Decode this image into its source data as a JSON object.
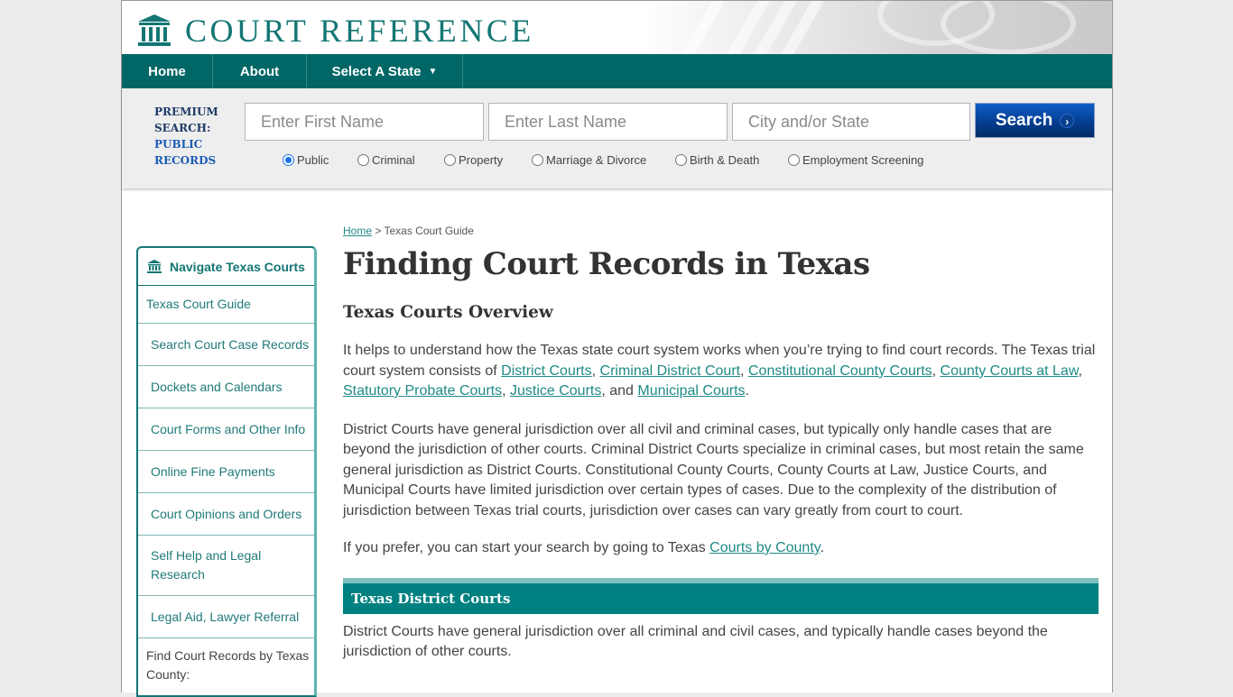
{
  "brand": {
    "name": "COURT REFERENCE",
    "accent": "#006766",
    "link": "#1f8a86"
  },
  "nav": [
    {
      "label": "Home"
    },
    {
      "label": "About"
    },
    {
      "label": "Select A State",
      "caret": "▼"
    }
  ],
  "search": {
    "premium_line1": "PREMIUM",
    "premium_line2": "SEARCH:",
    "premium_line3": "PUBLIC",
    "premium_line4": "RECORDS",
    "first_name_placeholder": "Enter First Name",
    "last_name_placeholder": "Enter Last Name",
    "city_state_placeholder": "City and/or State",
    "button_label": "Search",
    "button_arrow": "›",
    "radios": [
      {
        "label": "Public",
        "checked": true
      },
      {
        "label": "Criminal",
        "checked": false
      },
      {
        "label": "Property",
        "checked": false
      },
      {
        "label": "Marriage & Divorce",
        "checked": false
      },
      {
        "label": "Birth & Death",
        "checked": false
      },
      {
        "label": "Employment Screening",
        "checked": false
      }
    ]
  },
  "sidebar": {
    "title": "Navigate Texas Courts",
    "items": [
      {
        "label": "Texas Court Guide"
      },
      {
        "label": "Search Court Case Records"
      },
      {
        "label": "Dockets and Calendars"
      },
      {
        "label": "Court Forms and Other Info"
      },
      {
        "label": "Online Fine Payments"
      },
      {
        "label": "Court Opinions and Orders"
      },
      {
        "label": "Self Help and Legal Research"
      },
      {
        "label": "Legal Aid, Lawyer Referral"
      },
      {
        "label": "Find Court Records by Texas County:"
      }
    ]
  },
  "breadcrumb": {
    "home": "Home",
    "sep": " > ",
    "current": "Texas Court Guide"
  },
  "main": {
    "title": "Finding Court Records in Texas",
    "subtitle": "Texas Courts Overview",
    "p1": {
      "intro": "It helps to understand how the Texas state court system works when you’re trying to find court records. The Texas trial court system consists of ",
      "links": [
        "District Courts",
        "Criminal District Court",
        "Constitutional County Courts",
        "County Courts at Law",
        "Statutory Probate Courts",
        "Justice Courts",
        "Municipal Courts"
      ],
      "sep": ", ",
      "and": ", and ",
      "end": "."
    },
    "p2": "District Courts have general jurisdiction over all civil and criminal cases, but typically only handle cases that are beyond the jurisdiction of other courts. Criminal District Courts specialize in criminal cases, but most retain the same general jurisdiction as District Courts. Constitutional County Courts, County Courts at Law, Justice Courts, and Municipal Courts have limited jurisdiction over certain types of cases. Due to the complexity of the distribution of jurisdiction between Texas trial courts, jurisdiction over cases can vary greatly from court to court.",
    "p3": {
      "text": "If you prefer, you can start your search by going to Texas ",
      "link": "Courts by County",
      "end": "."
    },
    "section_title": "Texas District Courts",
    "p4": "District Courts have general jurisdiction over all criminal and civil cases, and typically handle cases beyond the jurisdiction of other courts."
  }
}
